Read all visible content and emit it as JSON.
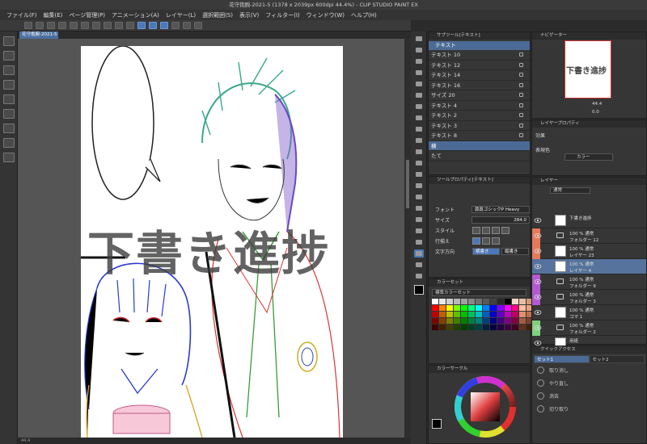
{
  "window": {
    "title": "花守抱腕-2021-5 (1378 x 2039px 600dpi 44.4%) - CLIP STUDIO PAINT EX"
  },
  "menu": [
    "ファイル(F)",
    "編集(E)",
    "ページ管理(P)",
    "アニメーション(A)",
    "レイヤー(L)",
    "選択範囲(S)",
    "表示(V)",
    "フィルター(I)",
    "ウィンドウ(W)",
    "ヘルプ(H)"
  ],
  "document": {
    "tab_label": "花守抱腕-2021-5",
    "status_zoom": "44.4"
  },
  "canvas": {
    "watermark": "下書き進捗"
  },
  "subtool": {
    "header": "サブツール[テキスト]",
    "selected_group": "テキスト",
    "items": [
      "テキスト 10",
      "テキスト 12",
      "テキスト 14",
      "テキスト 16",
      "サイズ 20",
      "テキスト 4",
      "テキスト 2",
      "テキスト 3",
      "テキスト 8",
      "横",
      "たて"
    ]
  },
  "tool_property": {
    "header": "ツールプロパティ[テキスト]",
    "font_label": "フォント",
    "font_value": "源真ゴシックP Heavy",
    "size_label": "サイズ",
    "size_value": "284.0",
    "style_label": "スタイル",
    "align_label": "行揃え",
    "direction_label": "文字方向",
    "direction_value": "横書き",
    "direction_value2": "縦書き"
  },
  "color_set": {
    "header": "カラーセット",
    "name": "標準カラーセット"
  },
  "color_wheel": {
    "header": "カラーサークル"
  },
  "navigator": {
    "header": "ナビゲーター",
    "zoom": "44.4",
    "angle": "0.0"
  },
  "layer_property": {
    "header": "レイヤープロパティ",
    "effect_label": "効果",
    "expression_label": "表現色",
    "expression_value": "カラー"
  },
  "layers": {
    "header": "レイヤー",
    "blend_mode": "通常",
    "rows": [
      {
        "line1": "下書き進捗",
        "line2": "",
        "color": "",
        "type": "text"
      },
      {
        "line1": "100 % 通常",
        "line2": "フォルダー 12",
        "color": "#e57a5a",
        "type": "folder"
      },
      {
        "line1": "100 % 通常",
        "line2": "レイヤー 23",
        "color": "#e57a5a",
        "type": "layer"
      },
      {
        "line1": "100 % 通常",
        "line2": "レイヤー 4",
        "color": "",
        "type": "layer"
      },
      {
        "line1": "100 % 通常",
        "line2": "フォルダー 9",
        "color": "#b45ad0",
        "type": "folder"
      },
      {
        "line1": "100 % 通常",
        "line2": "フォルダー 3",
        "color": "#b45ad0",
        "type": "folder"
      },
      {
        "line1": "100 % 通常",
        "line2": "コマ 1",
        "color": "",
        "type": "frame"
      },
      {
        "line1": "100 % 通常",
        "line2": "フォルダー 2",
        "color": "#7fd07f",
        "type": "folder"
      },
      {
        "line1": "用紙",
        "line2": "",
        "color": "",
        "type": "paper"
      }
    ]
  },
  "quick_access": {
    "header": "クイックアクセス",
    "tabs": [
      "セット1",
      "セット2"
    ],
    "items": [
      "取り消し",
      "やり直し",
      "消去",
      "切り取り"
    ]
  }
}
